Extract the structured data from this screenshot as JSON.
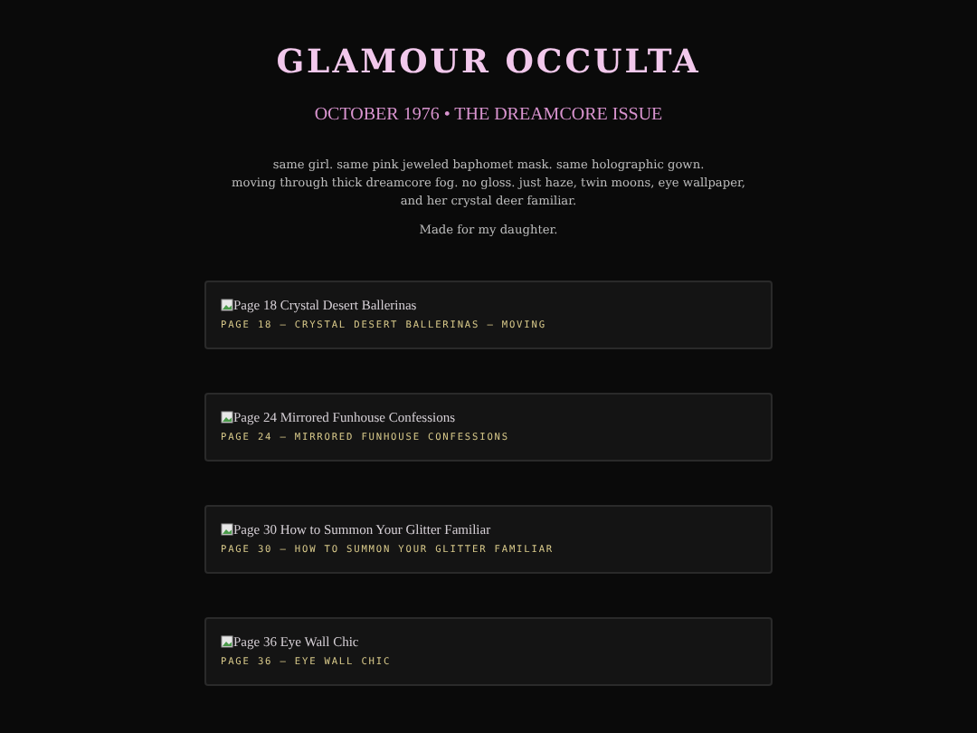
{
  "title": "GLAMOUR OCCULTA",
  "issue": "OCTOBER 1976 • THE DREAMCORE ISSUE",
  "description": [
    "same girl. same pink jeweled baphomet mask. same holographic gown.",
    "moving through thick dreamcore fog. no gloss. just haze, twin moons, eye wallpaper,",
    "and her crystal deer familiar."
  ],
  "dedication": "Made for my daughter.",
  "pages": [
    {
      "alt": "Page 18 Crystal Desert Ballerinas",
      "caption": "PAGE 18 — CRYSTAL DESERT BALLERINAS — MOVING"
    },
    {
      "alt": "Page 24 Mirrored Funhouse Confessions",
      "caption": "PAGE 24 — MIRRORED FUNHOUSE CONFESSIONS"
    },
    {
      "alt": "Page 30 How to Summon Your Glitter Familiar",
      "caption": "PAGE 30 — HOW TO SUMMON YOUR GLITTER FAMILIAR"
    },
    {
      "alt": "Page 36 Eye Wall Chic",
      "caption": "PAGE 36 — EYE WALL CHIC"
    }
  ]
}
